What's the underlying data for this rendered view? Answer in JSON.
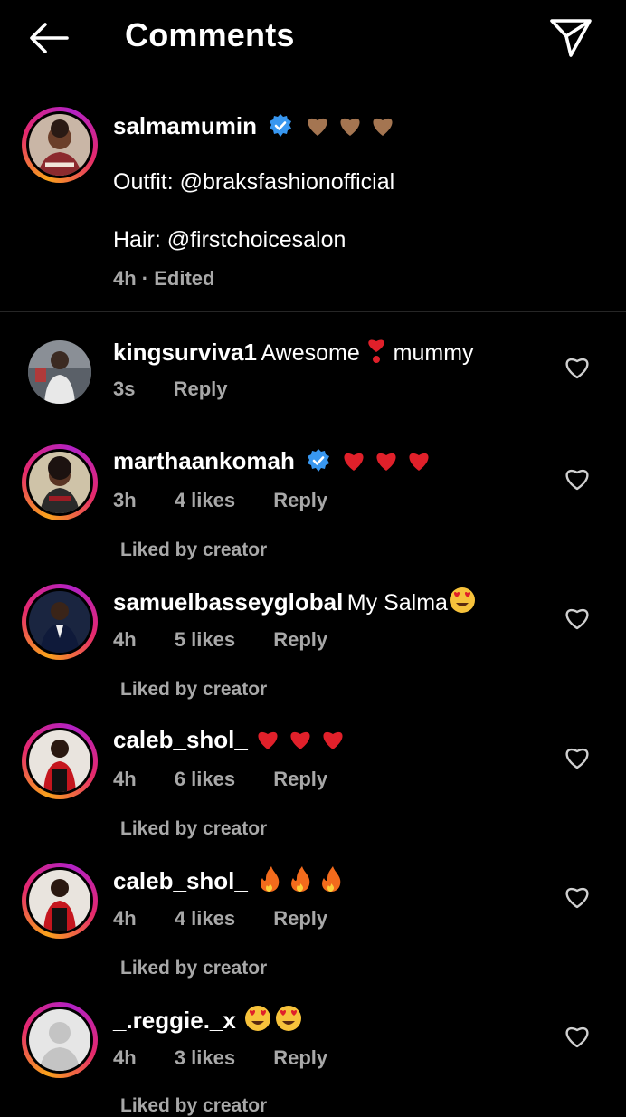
{
  "header": {
    "title": "Comments"
  },
  "caption": {
    "username": "salmamumin",
    "line1": "Outfit: @braksfashionofficial",
    "line2": "Hair: @firstchoicesalon",
    "meta": "4h · Edited"
  },
  "comments": [
    {
      "username": "kingsurviva1",
      "text_a": "Awesome",
      "text_b": "mummy",
      "time": "3s",
      "likes": "",
      "reply": "Reply",
      "liked_by": ""
    },
    {
      "username": "marthaankomah",
      "time": "3h",
      "likes": "4 likes",
      "reply": "Reply",
      "liked_by": "Liked by creator"
    },
    {
      "username": "samuelbasseyglobal",
      "text": "My Salma",
      "time": "4h",
      "likes": "5 likes",
      "reply": "Reply",
      "liked_by": "Liked by creator"
    },
    {
      "username": "caleb_shol_",
      "time": "4h",
      "likes": "6 likes",
      "reply": "Reply",
      "liked_by": "Liked by creator"
    },
    {
      "username": "caleb_shol_",
      "time": "4h",
      "likes": "4 likes",
      "reply": "Reply",
      "liked_by": "Liked by creator"
    },
    {
      "username": "_.reggie._x",
      "time": "4h",
      "likes": "3 likes",
      "reply": "Reply",
      "liked_by": "Liked by creator"
    }
  ],
  "icons": {
    "back": "arrow-left-icon",
    "send": "paper-plane-icon",
    "verified": "verified-badge-icon",
    "like": "heart-outline-icon"
  },
  "colors": {
    "background": "#000000",
    "secondary_text": "#a8a8a8",
    "verified": "#3897f0",
    "red_heart": "#e0202a",
    "brown_heart": "#a47551"
  }
}
